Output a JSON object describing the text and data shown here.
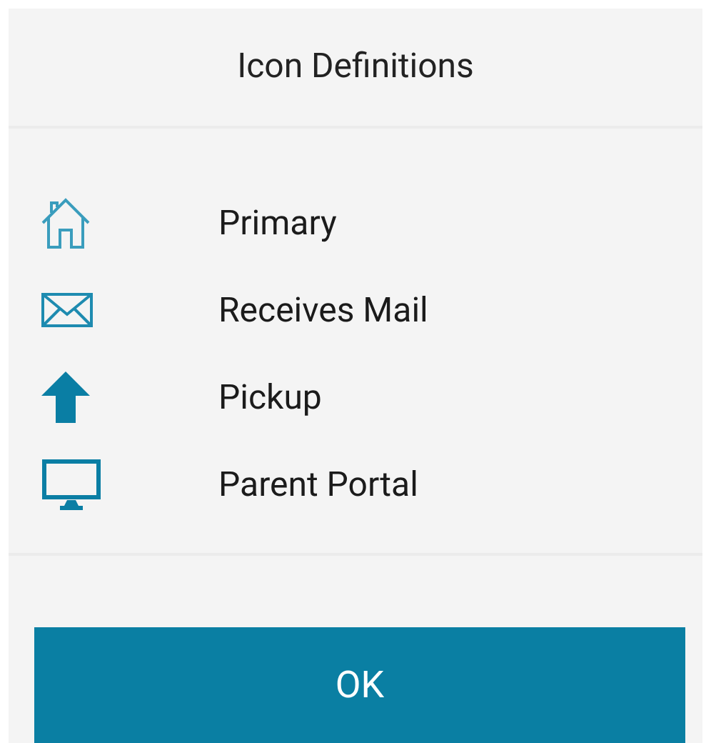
{
  "dialog": {
    "title": "Icon Definitions",
    "items": [
      {
        "kind": "house",
        "label": "Primary"
      },
      {
        "kind": "mail",
        "label": "Receives Mail"
      },
      {
        "kind": "pickup",
        "label": "Pickup"
      },
      {
        "kind": "monitor",
        "label": "Parent Portal"
      }
    ],
    "button": "OK"
  }
}
